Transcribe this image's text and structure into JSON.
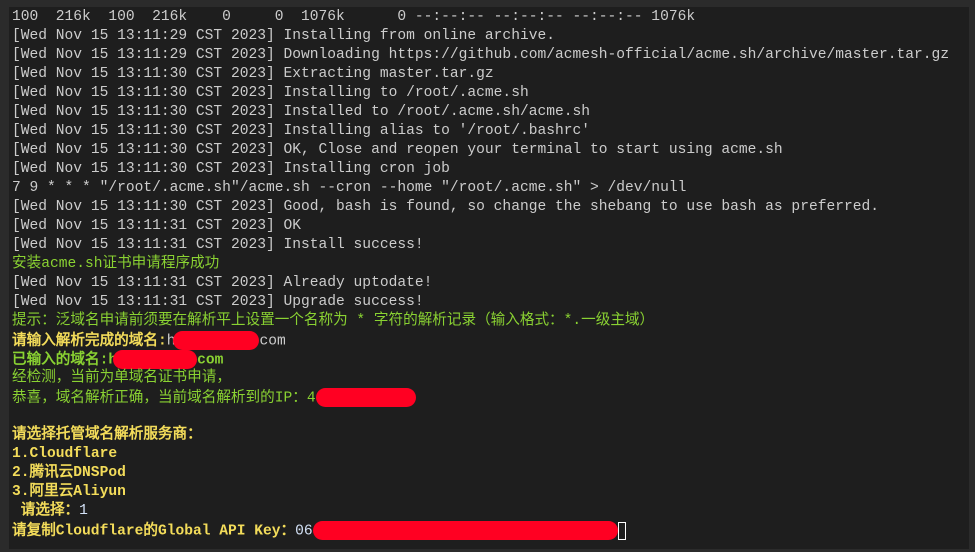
{
  "terminal": {
    "log_lines": [
      "100  216k  100  216k    0     0  1076k      0 --:--:-- --:--:-- --:--:-- 1076k",
      "[Wed Nov 15 13:11:29 CST 2023] Installing from online archive.",
      "[Wed Nov 15 13:11:29 CST 2023] Downloading https://github.com/acmesh-official/acme.sh/archive/master.tar.gz",
      "[Wed Nov 15 13:11:30 CST 2023] Extracting master.tar.gz",
      "[Wed Nov 15 13:11:30 CST 2023] Installing to /root/.acme.sh",
      "[Wed Nov 15 13:11:30 CST 2023] Installed to /root/.acme.sh/acme.sh",
      "[Wed Nov 15 13:11:30 CST 2023] Installing alias to '/root/.bashrc'",
      "[Wed Nov 15 13:11:30 CST 2023] OK, Close and reopen your terminal to start using acme.sh",
      "[Wed Nov 15 13:11:30 CST 2023] Installing cron job",
      "7 9 * * * \"/root/.acme.sh\"/acme.sh --cron --home \"/root/.acme.sh\" > /dev/null",
      "[Wed Nov 15 13:11:30 CST 2023] Good, bash is found, so change the shebang to use bash as preferred.",
      "[Wed Nov 15 13:11:31 CST 2023] OK",
      "[Wed Nov 15 13:11:31 CST 2023] Install success!"
    ],
    "install_ok": "安装acme.sh证书申请程序成功",
    "log_lines2": [
      "[Wed Nov 15 13:11:31 CST 2023] Already uptodate!",
      "[Wed Nov 15 13:11:31 CST 2023] Upgrade success!"
    ],
    "hint": "提示：泛域名申请前须要在解析平上设置一个名称为 * 字符的解析记录（输入格式：*.一级主域）",
    "prompt_domain": "请输入解析完成的域名:",
    "domain_input_start": "h",
    "domain_input_end": "com",
    "entered_label": "已输入的域名:",
    "entered_start": "h",
    "entered_end": "com",
    "check": "经检测，当前为单域名证书申请，",
    "resolve_ok": "恭喜，域名解析正确，当前域名解析到的IP：",
    "ip_start": "4",
    "choose_provider": "请选择托管域名解析服务商：",
    "providers": [
      "1.Cloudflare",
      "2.腾讯云DNSPod",
      "3.阿里云Aliyun"
    ],
    "choose_prompt": " 请选择：",
    "choose_value": "1",
    "api_key_prompt": "请复制Cloudflare的Global API Key：",
    "api_key_start": "06"
  },
  "colors": {
    "background": "#1e1e1e",
    "text": "#cccccc",
    "green": "#8ad232",
    "yellow": "#f3dc5a",
    "redaction": "#ff0022"
  }
}
